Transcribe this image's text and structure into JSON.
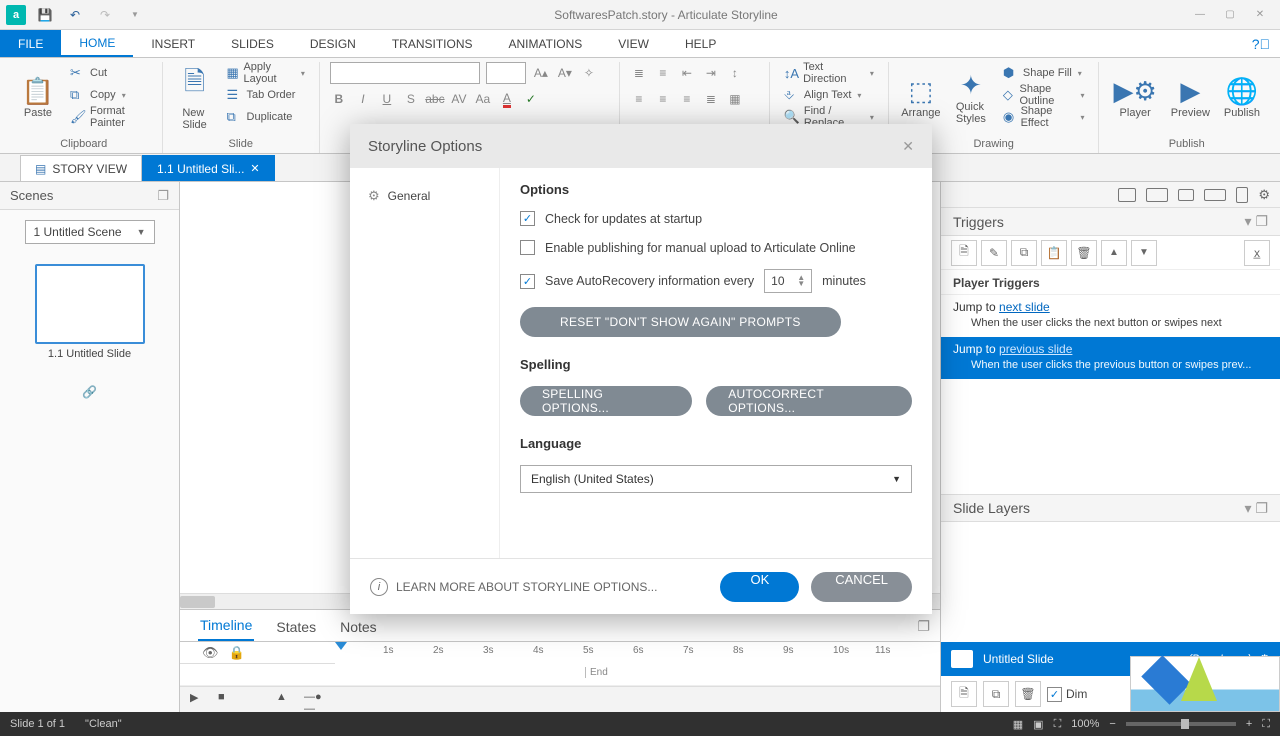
{
  "titlebar": {
    "title": "SoftwaresPatch.story - Articulate Storyline"
  },
  "ribbon_tabs": {
    "file": "FILE",
    "home": "HOME",
    "insert": "INSERT",
    "slides": "SLIDES",
    "design": "DESIGN",
    "transitions": "TRANSITIONS",
    "animations": "ANIMATIONS",
    "view": "VIEW",
    "help": "HELP"
  },
  "ribbon": {
    "clipboard": {
      "paste": "Paste",
      "cut": "Cut",
      "copy": "Copy",
      "format_painter": "Format Painter",
      "label": "Clipboard"
    },
    "slide": {
      "new_slide": "New\nSlide",
      "apply_layout": "Apply Layout",
      "tab_order": "Tab Order",
      "duplicate": "Duplicate",
      "label": "Slide"
    },
    "drawing": {
      "arrange": "Arrange",
      "quick_styles": "Quick\nStyles",
      "shape_fill": "Shape Fill",
      "shape_outline": "Shape Outline",
      "shape_effect": "Shape Effect",
      "label": "Drawing"
    },
    "text": {
      "text_direction": "Text Direction",
      "align_text": "Align Text",
      "find_replace": "Find / Replace"
    },
    "publish": {
      "player": "Player",
      "preview": "Preview",
      "publish": "Publish",
      "label": "Publish"
    }
  },
  "doctabs": {
    "story_view": "STORY VIEW",
    "slide_tab": "1.1 Untitled Sli..."
  },
  "scenes": {
    "title": "Scenes",
    "selector": "1 Untitled Scene",
    "thumb_label": "1.1 Untitled Slide"
  },
  "bottom": {
    "timeline": "Timeline",
    "states": "States",
    "notes": "Notes",
    "ticks": [
      "1s",
      "2s",
      "3s",
      "4s",
      "5s",
      "6s",
      "7s",
      "8s",
      "9s",
      "10s",
      "11s"
    ],
    "end": "End"
  },
  "right": {
    "triggers_title": "Triggers",
    "player_triggers": "Player Triggers",
    "t1_a": "Jump to ",
    "t1_link": "next slide",
    "t1_sub": "When the user clicks the next button or swipes next",
    "t2_a": "Jump to ",
    "t2_link": "previous slide",
    "t2_sub": "When the user clicks the previous button or swipes prev...",
    "layers_title": "Slide Layers",
    "layer_name": "Untitled Slide",
    "base_layer": "(Base Layer)",
    "dim": "Dim"
  },
  "dialog": {
    "title": "Storyline Options",
    "nav_general": "General",
    "h_options": "Options",
    "opt_updates": "Check for updates at startup",
    "opt_publish": "Enable publishing for manual upload to Articulate Online",
    "opt_autorec": "Save AutoRecovery information every",
    "autorec_val": "10",
    "autorec_unit": "minutes",
    "reset_btn": "RESET \"DON'T SHOW AGAIN\" PROMPTS",
    "h_spelling": "Spelling",
    "spelling_btn": "SPELLING OPTIONS...",
    "autocorrect_btn": "AUTOCORRECT OPTIONS...",
    "h_language": "Language",
    "language_val": "English (United States)",
    "learn_more": "LEARN MORE ABOUT STORYLINE OPTIONS...",
    "ok": "OK",
    "cancel": "CANCEL"
  },
  "status": {
    "slide": "Slide 1 of 1",
    "theme": "\"Clean\"",
    "zoom": "100%"
  }
}
